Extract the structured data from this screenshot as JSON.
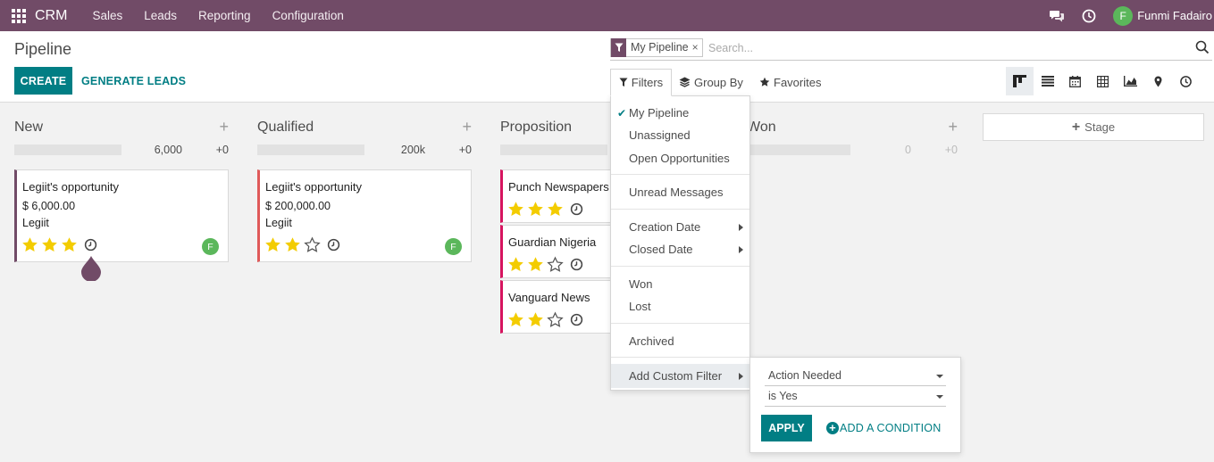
{
  "navbar": {
    "brand": "CRM",
    "menu": [
      "Sales",
      "Leads",
      "Reporting",
      "Configuration"
    ],
    "user_initial": "F",
    "user_name": "Funmi Fadairo",
    "icons": [
      "apps-grid-icon",
      "chat-icon",
      "activity-clock-icon"
    ]
  },
  "control": {
    "title": "Pipeline",
    "create_label": "CREATE",
    "generate_label": "GENERATE LEADS"
  },
  "search": {
    "facet_label": "My Pipeline",
    "facet_remove": "×",
    "placeholder": "Search..."
  },
  "search_options": {
    "filters": "Filters",
    "group_by": "Group By",
    "favorites": "Favorites"
  },
  "views": [
    "kanban-view-icon",
    "list-view-icon",
    "calendar-view-icon",
    "pivot-view-icon",
    "graph-view-icon",
    "map-view-icon",
    "activity-view-icon"
  ],
  "columns": [
    {
      "title": "New",
      "plus": "+",
      "amount": "6,000",
      "count": "+0",
      "cards": [
        {
          "name": "Legiit's opportunity",
          "revenue": "$ 6,000.00",
          "customer": "Legiit",
          "stars": 3,
          "avatar": "F",
          "border": "#714b67"
        }
      ]
    },
    {
      "title": "Qualified",
      "plus": "+",
      "amount": "200k",
      "count": "+0",
      "cards": [
        {
          "name": "Legiit's opportunity",
          "revenue": "$ 200,000.00",
          "customer": "Legiit",
          "stars": 2,
          "avatar": "F",
          "border": "#e05a5a"
        }
      ]
    },
    {
      "title": "Proposition",
      "cards": [
        {
          "name": "Punch Newspapers",
          "stars": 3,
          "border": "#d6145f"
        },
        {
          "name": "Guardian Nigeria",
          "stars": 2,
          "border": "#d6145f"
        },
        {
          "name": "Vanguard News",
          "stars": 2,
          "border": "#d6145f"
        }
      ]
    },
    {
      "title": "Won",
      "plus": "+",
      "amount": "0",
      "count": "+0"
    }
  ],
  "stage_add_label": "Stage",
  "filters_menu": {
    "items": [
      {
        "label": "My Pipeline",
        "checked": true
      },
      {
        "label": "Unassigned"
      },
      {
        "label": "Open Opportunities"
      },
      {
        "label": "Unread Messages"
      },
      {
        "label": "Creation Date",
        "submenu": true
      },
      {
        "label": "Closed Date",
        "submenu": true
      },
      {
        "label": "Won"
      },
      {
        "label": "Lost"
      },
      {
        "label": "Archived"
      },
      {
        "label": "Add Custom Filter",
        "submenu": true
      }
    ],
    "check_mark": "✔"
  },
  "custom_filter": {
    "field": "Action Needed",
    "operator": "is Yes",
    "apply_label": "APPLY",
    "add_condition_label": "ADD A CONDITION"
  },
  "colors": {
    "navbar": "#714b67",
    "primary": "#017e84",
    "star": "#f3cc00"
  }
}
